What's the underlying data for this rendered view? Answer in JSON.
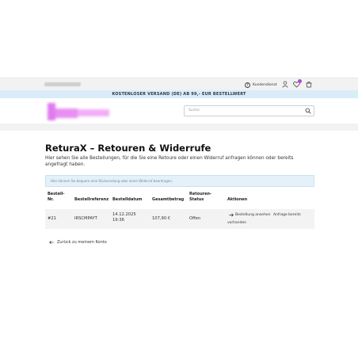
{
  "topbar": {
    "kundendienst_label": "Kundendienst"
  },
  "promo": {
    "text": "KOSTENLOSER VERSAND (DE) AB 99,- EUR BESTELLWERT"
  },
  "search": {
    "placeholder": "Suche"
  },
  "page": {
    "title": "ReturaX – Retouren & Widerrufe",
    "intro": "Hier sehen Sie alle Bestellungen, für die Sie eine Retoure oder einen Widerruf anfragen können oder bereits angefragt haben.",
    "info": "Hier können Sie bequem eine Rücksendung oder einen Widerruf beantragen."
  },
  "table": {
    "headers": {
      "order_nr": [
        "Bestell-",
        "Nr."
      ],
      "reference": "Bestellreferenz",
      "date": "Bestelldatum",
      "total": "Gesamtbetrag",
      "status": [
        "Retouren-",
        "Status"
      ],
      "actions": "Aktionen"
    },
    "rows": [
      {
        "order_nr": "#21",
        "reference": "IRSCMPAYT",
        "date": [
          "14.12.2025",
          "19:36"
        ],
        "total": "107,90 €",
        "status": "Offen",
        "action_view": "Bestellung ansehen",
        "action_request": [
          "Anfrage bereits",
          "vorhanden"
        ]
      }
    ]
  },
  "back_link": "Zurück zu meinem Konto",
  "colors": {
    "promo_bg": "#d9ecf8",
    "info_bg": "#e4f1f9",
    "logo": "#d06ce0",
    "badge": "#b04bd6"
  }
}
